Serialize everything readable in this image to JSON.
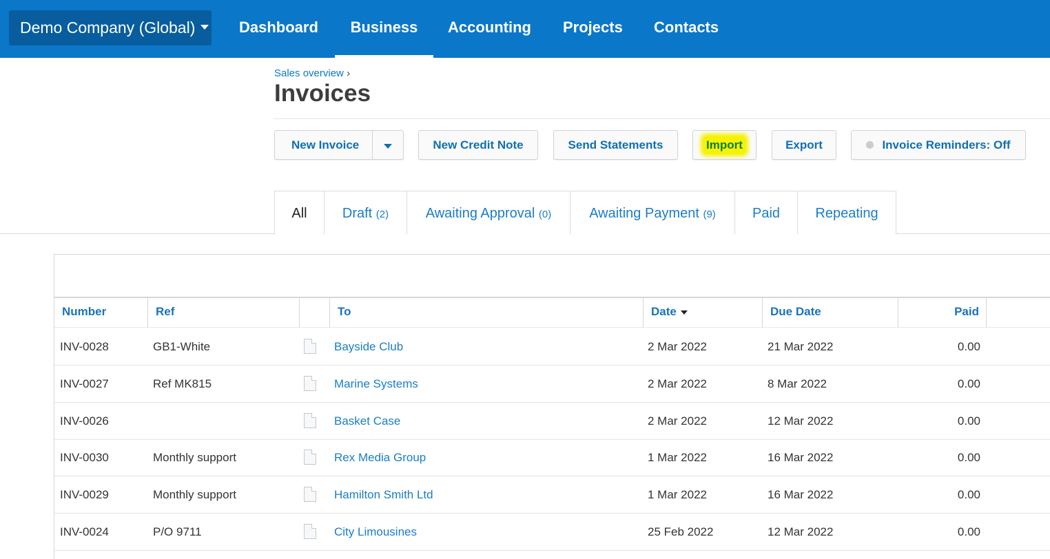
{
  "topnav": {
    "org": "Demo Company (Global)",
    "items": [
      {
        "label": "Dashboard"
      },
      {
        "label": "Business"
      },
      {
        "label": "Accounting"
      },
      {
        "label": "Projects"
      },
      {
        "label": "Contacts"
      }
    ],
    "active": "Business",
    "color": "#0b77c9"
  },
  "header": {
    "breadcrumb": "Sales overview",
    "breadcrumb_sep": "›",
    "title": "Invoices"
  },
  "toolbar": {
    "new_invoice": "New Invoice",
    "new_credit_note": "New Credit Note",
    "send_statements": "Send Statements",
    "import": "Import",
    "export": "Export",
    "reminders": "Invoice Reminders: Off",
    "highlight_color": "#f5f205"
  },
  "tabs": [
    {
      "label": "All",
      "count": ""
    },
    {
      "label": "Draft",
      "count": "(2)"
    },
    {
      "label": "Awaiting Approval",
      "count": "(0)"
    },
    {
      "label": "Awaiting Payment",
      "count": "(9)"
    },
    {
      "label": "Paid",
      "count": ""
    },
    {
      "label": "Repeating",
      "count": ""
    }
  ],
  "table": {
    "columns": {
      "number": "Number",
      "ref": "Ref",
      "to": "To",
      "date": "Date",
      "due": "Due Date",
      "paid": "Paid"
    },
    "rows": [
      {
        "number": "INV-0028",
        "ref": "GB1-White",
        "to": "Bayside Club",
        "date": "2 Mar 2022",
        "due": "21 Mar 2022",
        "paid": "0.00"
      },
      {
        "number": "INV-0027",
        "ref": "Ref MK815",
        "to": "Marine Systems",
        "date": "2 Mar 2022",
        "due": "8 Mar 2022",
        "paid": "0.00"
      },
      {
        "number": "INV-0026",
        "ref": "",
        "to": "Basket Case",
        "date": "2 Mar 2022",
        "due": "12 Mar 2022",
        "paid": "0.00"
      },
      {
        "number": "INV-0030",
        "ref": "Monthly support",
        "to": "Rex Media Group",
        "date": "1 Mar 2022",
        "due": "16 Mar 2022",
        "paid": "0.00"
      },
      {
        "number": "INV-0029",
        "ref": "Monthly support",
        "to": "Hamilton Smith Ltd",
        "date": "1 Mar 2022",
        "due": "16 Mar 2022",
        "paid": "0.00"
      },
      {
        "number": "INV-0024",
        "ref": "P/O 9711",
        "to": "City Limousines",
        "date": "25 Feb 2022",
        "due": "12 Mar 2022",
        "paid": "0.00"
      }
    ]
  }
}
